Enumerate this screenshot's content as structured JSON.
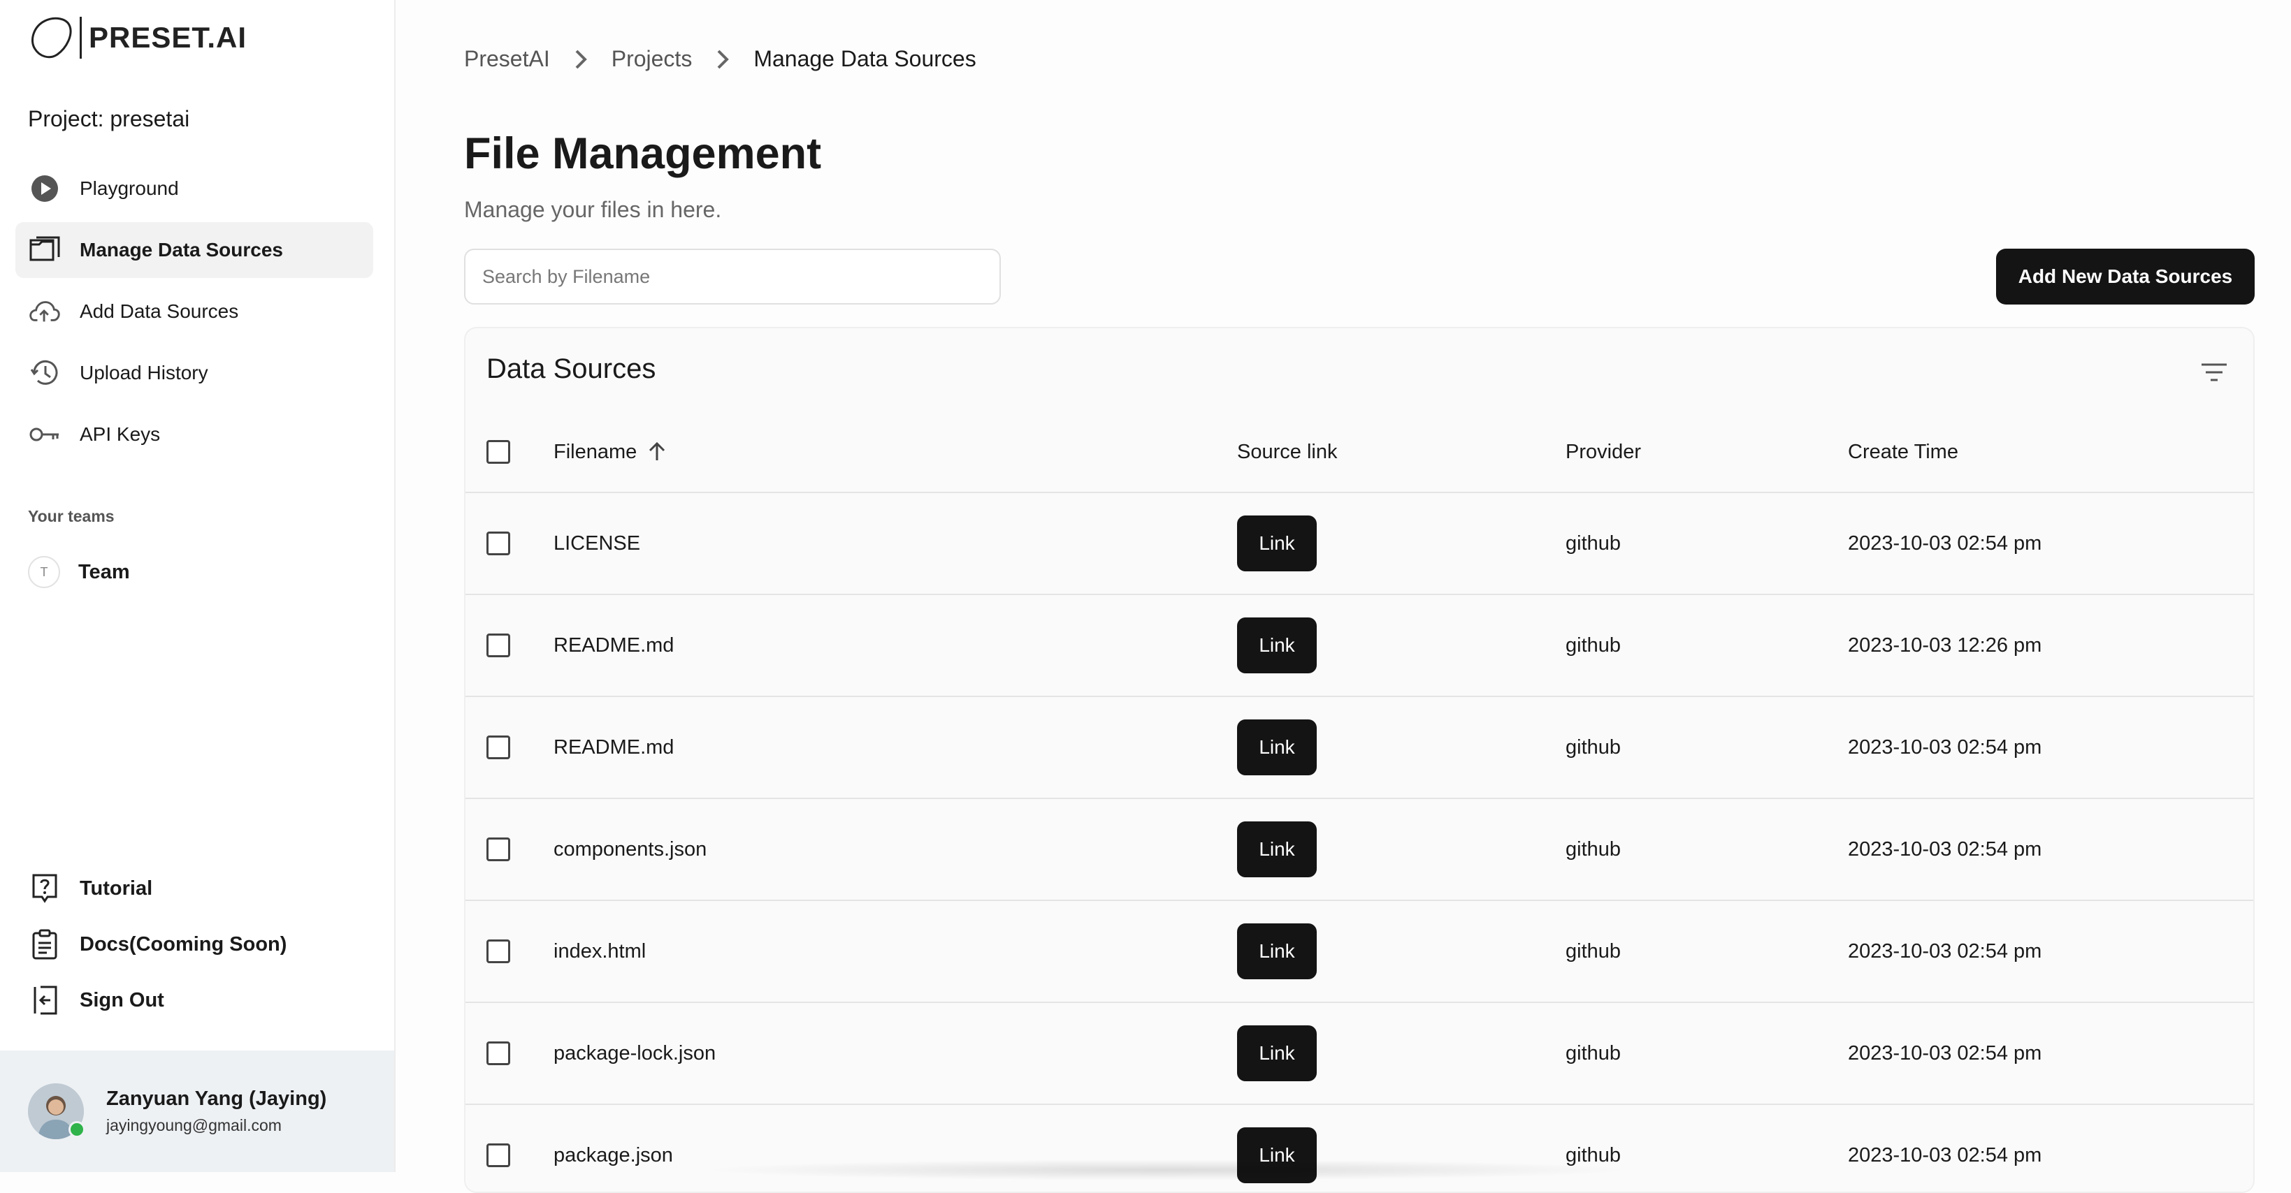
{
  "logo": {
    "text": "PRESET.AI"
  },
  "project": {
    "label": "Project: presetai"
  },
  "sidebar": {
    "items": [
      {
        "label": "Playground",
        "icon": "play-circle-icon"
      },
      {
        "label": "Manage Data Sources",
        "icon": "folders-icon",
        "active": true
      },
      {
        "label": "Add Data Sources",
        "icon": "cloud-upload-icon"
      },
      {
        "label": "Upload History",
        "icon": "history-icon"
      },
      {
        "label": "API Keys",
        "icon": "key-icon"
      }
    ],
    "teams_label": "Your teams",
    "team": {
      "initial": "T",
      "name": "Team"
    },
    "bottom_items": [
      {
        "label": "Tutorial",
        "icon": "help-icon"
      },
      {
        "label": "Docs(Cooming Soon)",
        "icon": "clipboard-icon"
      },
      {
        "label": "Sign Out",
        "icon": "sign-out-icon"
      }
    ],
    "user": {
      "name": "Zanyuan Yang (Jaying)",
      "email": "jayingyoung@gmail.com",
      "status": "online"
    }
  },
  "breadcrumb": [
    "PresetAI",
    "Projects",
    "Manage Data Sources"
  ],
  "page": {
    "title": "File Management",
    "subtitle": "Manage your files in here.",
    "search_placeholder": "Search by Filename",
    "add_button": "Add New Data Sources"
  },
  "table": {
    "title": "Data Sources",
    "headers": {
      "filename": "Filename",
      "source_link": "Source link",
      "provider": "Provider",
      "create_time": "Create Time"
    },
    "rows": [
      {
        "filename": "LICENSE",
        "link": "Link",
        "provider": "github",
        "time": "2023-10-03 02:54 pm"
      },
      {
        "filename": "README.md",
        "link": "Link",
        "provider": "github",
        "time": "2023-10-03 12:26 pm"
      },
      {
        "filename": "README.md",
        "link": "Link",
        "provider": "github",
        "time": "2023-10-03 02:54 pm"
      },
      {
        "filename": "components.json",
        "link": "Link",
        "provider": "github",
        "time": "2023-10-03 02:54 pm"
      },
      {
        "filename": "index.html",
        "link": "Link",
        "provider": "github",
        "time": "2023-10-03 02:54 pm"
      },
      {
        "filename": "package-lock.json",
        "link": "Link",
        "provider": "github",
        "time": "2023-10-03 02:54 pm"
      },
      {
        "filename": "package.json",
        "link": "Link",
        "provider": "github",
        "time": "2023-10-03 02:54 pm"
      }
    ]
  },
  "colors": {
    "primary_button": "#141414",
    "online": "#2fb34a",
    "active_nav_bg": "#f2f2f2"
  }
}
